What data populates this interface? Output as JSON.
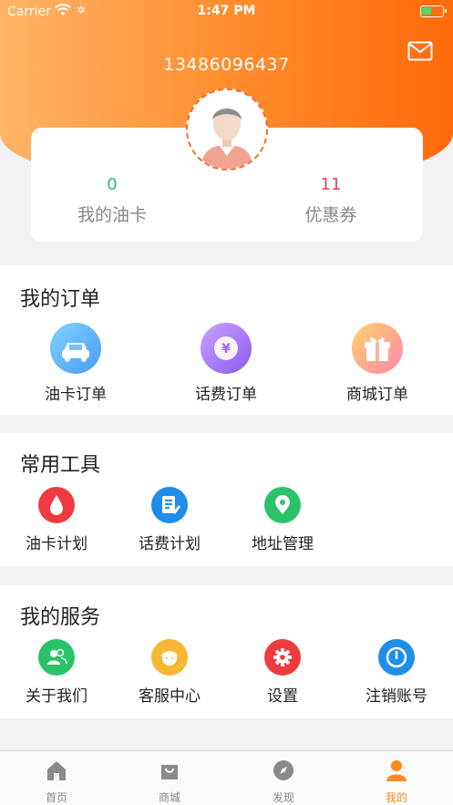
{
  "status_bar": {
    "carrier": "Carrier",
    "time": "1:47 PM"
  },
  "header": {
    "phone": "13486096437"
  },
  "summary": {
    "oil_card_count": "0",
    "oil_card_label": "我的油卡",
    "coupon_count": "11",
    "coupon_label": "优惠券"
  },
  "orders": {
    "title": "我的订单",
    "items": [
      {
        "label": "油卡订单",
        "icon": "car-icon"
      },
      {
        "label": "话费订单",
        "icon": "yen-coin-icon"
      },
      {
        "label": "商城订单",
        "icon": "gift-icon"
      }
    ]
  },
  "tools": {
    "title": "常用工具",
    "items": [
      {
        "label": "油卡计划",
        "icon": "drop-icon"
      },
      {
        "label": "话费计划",
        "icon": "notepad-icon"
      },
      {
        "label": "地址管理",
        "icon": "location-pin-icon"
      }
    ]
  },
  "services": {
    "title": "我的服务",
    "items": [
      {
        "label": "关于我们",
        "icon": "users-icon"
      },
      {
        "label": "客服中心",
        "icon": "support-agent-icon"
      },
      {
        "label": "设置",
        "icon": "gear-icon"
      },
      {
        "label": "注销账号",
        "icon": "power-icon"
      }
    ]
  },
  "tabbar": {
    "items": [
      {
        "label": "首页",
        "icon": "home-icon"
      },
      {
        "label": "商城",
        "icon": "shopping-bag-icon"
      },
      {
        "label": "发现",
        "icon": "compass-icon"
      },
      {
        "label": "我的",
        "icon": "person-icon"
      }
    ],
    "active": "我的"
  },
  "colors": {
    "header_gradient": [
      "#ffb466",
      "#ff6a0c"
    ],
    "accent": "#ff8a1a",
    "green": "#2bb58a",
    "red": "#e2464a"
  }
}
